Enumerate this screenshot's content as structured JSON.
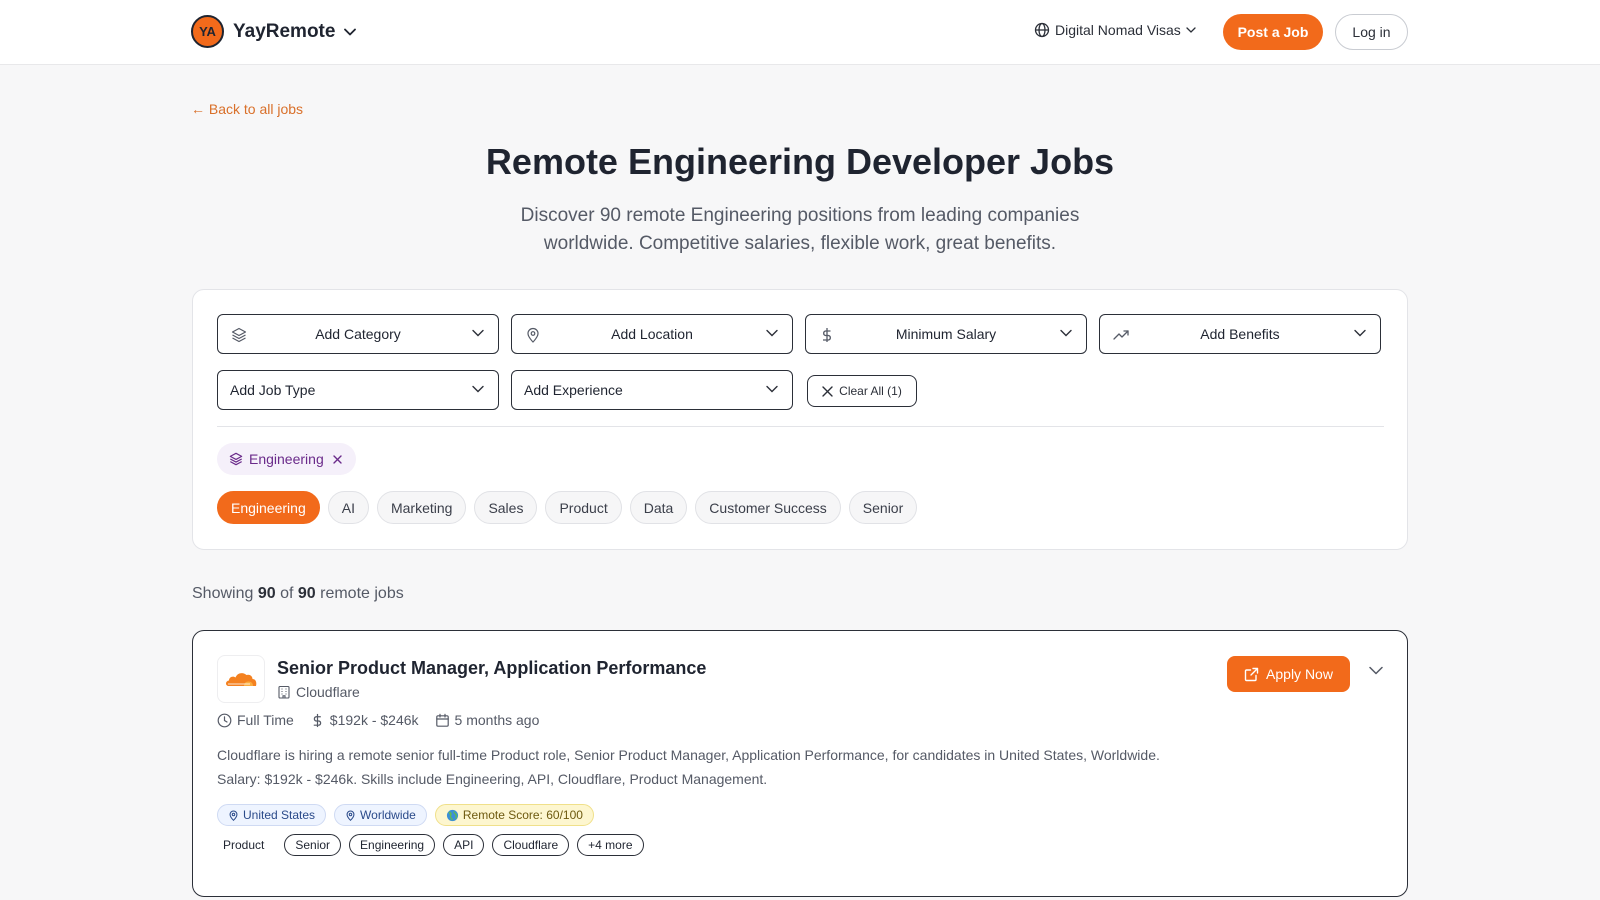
{
  "header": {
    "logo_initials": "YA",
    "brand": "YayRemote",
    "nav_visas": "Digital Nomad Visas",
    "post_job": "Post a Job",
    "login": "Log in"
  },
  "page": {
    "back_link": "← Back to all jobs",
    "title": "Remote Engineering Developer Jobs",
    "subtitle": "Discover 90 remote Engineering positions from leading companies worldwide. Competitive salaries, flexible work, great benefits."
  },
  "filters": {
    "category": "Add Category",
    "location": "Add Location",
    "salary": "Minimum Salary",
    "benefits": "Add Benefits",
    "job_type": "Add Job Type",
    "experience": "Add Experience",
    "clear_all": "Clear All (1)",
    "active_chip": "Engineering",
    "quick_tags": [
      "Engineering",
      "AI",
      "Marketing",
      "Sales",
      "Product",
      "Data",
      "Customer Success",
      "Senior"
    ]
  },
  "results": {
    "prefix": "Showing",
    "shown": "90",
    "of": "of",
    "total": "90",
    "suffix": "remote jobs"
  },
  "job": {
    "title": "Senior Product Manager, Application Performance",
    "company": "Cloudflare",
    "type": "Full Time",
    "salary": "$192k - $246k",
    "posted": "5 months ago",
    "description_line1": "Cloudflare is hiring a remote senior full-time Product role, Senior Product Manager, Application Performance, for candidates in United States, Worldwide.",
    "description_line2": "Salary: $192k - $246k. Skills include Engineering, API, Cloudflare, Product Management.",
    "locations": [
      "United States",
      "Worldwide"
    ],
    "remote_score": "Remote Score: 60/100",
    "category_label": "Product",
    "skills": [
      "Senior",
      "Engineering",
      "API",
      "Cloudflare"
    ],
    "more": "+4 more",
    "apply": "Apply Now"
  },
  "colors": {
    "accent": "#f26a1b",
    "text": "#1f2430",
    "muted": "#555a66",
    "chip_purple": "#6a2a8a",
    "score_bg": "#fdf6cf",
    "location_bg": "#eef4ff"
  },
  "icons": {
    "visas": "globe-icon",
    "category": "layers-icon",
    "location": "map-pin-icon",
    "salary": "dollar-icon",
    "benefits": "trending-up-icon",
    "clear": "close-icon",
    "company": "building-icon",
    "type": "clock-icon",
    "posted": "calendar-icon",
    "apply": "external-link-icon",
    "expand": "chevron-down-icon",
    "score": "globe-emoji-icon"
  }
}
